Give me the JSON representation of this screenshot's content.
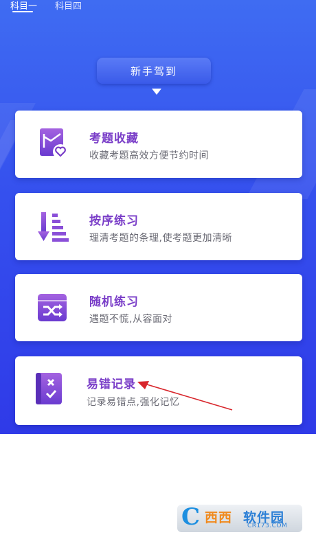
{
  "tabs": [
    {
      "label": "科目一",
      "active": true
    },
    {
      "label": "科目四",
      "active": false
    }
  ],
  "banner": {
    "label": "新手驾到"
  },
  "cards": [
    {
      "title": "考题收藏",
      "desc": "收藏考题高效方便节约时间",
      "icon": "favorite-questions-icon"
    },
    {
      "title": "按序练习",
      "desc": "理清考题的条理,使考题更加清晰",
      "icon": "sequential-practice-icon"
    },
    {
      "title": "随机练习",
      "desc": "遇题不慌,从容面对",
      "icon": "shuffle-icon"
    },
    {
      "title": "易错记录",
      "desc": "记录易错点,强化记忆",
      "icon": "error-notebook-icon"
    }
  ],
  "watermark": {
    "brand_a": "西西",
    "brand_b": "软件园",
    "url": "CR173.COM",
    "glyph": "C"
  },
  "colors": {
    "primary": "#3550ee",
    "accent": "#7a3ec8",
    "annotation_arrow": "#d8262c"
  }
}
